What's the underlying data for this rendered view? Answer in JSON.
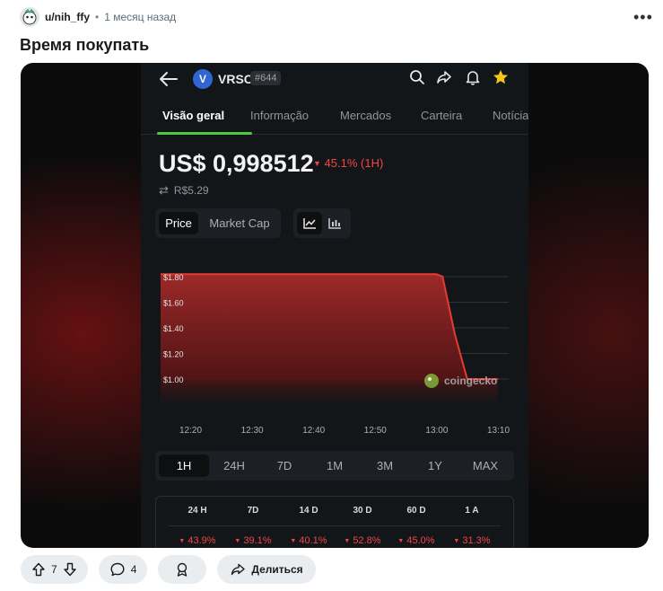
{
  "post": {
    "username": "u/nih_ffy",
    "separator": "•",
    "time": "1 месяц назад",
    "more": "•••",
    "title": "Время покупать"
  },
  "app": {
    "coin_symbol": "VRSC",
    "coin_logo_letter": "V",
    "rank": "#644",
    "tabs": [
      {
        "label": "Visão geral",
        "active": true
      },
      {
        "label": "Informação",
        "active": false
      },
      {
        "label": "Mercados",
        "active": false
      },
      {
        "label": "Carteira",
        "active": false
      },
      {
        "label": "Notícia",
        "active": false
      }
    ],
    "price": "US$ 0,998512",
    "change": "45.1% (1H)",
    "brl_price": "R$5.29",
    "chart_toggle": [
      "Price",
      "Market Cap"
    ],
    "watermark": "coingecko",
    "ranges": [
      "1H",
      "24H",
      "7D",
      "1M",
      "3M",
      "1Y",
      "MAX"
    ],
    "active_range": "1H",
    "perf_headers": [
      "24 H",
      "7D",
      "14 D",
      "30 D",
      "60 D",
      "1 A"
    ],
    "perf_values": [
      "43.9%",
      "39.1%",
      "40.1%",
      "52.8%",
      "45.0%",
      "31.3%"
    ],
    "colors": {
      "accent_green": "#4bcc3e",
      "negative_red": "#f04545",
      "star_yellow": "#f5c518",
      "coin_blue": "#3165d4"
    }
  },
  "chart_data": {
    "type": "area",
    "title": "",
    "xlabel": "",
    "ylabel": "",
    "y_ticks": [
      "$1.80",
      "$1.60",
      "$1.40",
      "$1.20",
      "$1.00"
    ],
    "x_ticks": [
      "12:20",
      "12:30",
      "12:40",
      "12:50",
      "13:00",
      "13:10"
    ],
    "ylim": [
      1.0,
      1.8
    ],
    "series": [
      {
        "x": [
          "12:15",
          "12:20",
          "12:30",
          "12:40",
          "12:50",
          "13:00",
          "13:01",
          "13:03",
          "13:05",
          "13:10"
        ],
        "y": [
          1.82,
          1.82,
          1.82,
          1.82,
          1.82,
          1.82,
          1.8,
          1.35,
          1.0,
          1.0
        ]
      }
    ],
    "grid": true,
    "line_color": "#e43b32"
  },
  "actions": {
    "upvotes": "7",
    "comments": "4",
    "share": "Делиться"
  }
}
